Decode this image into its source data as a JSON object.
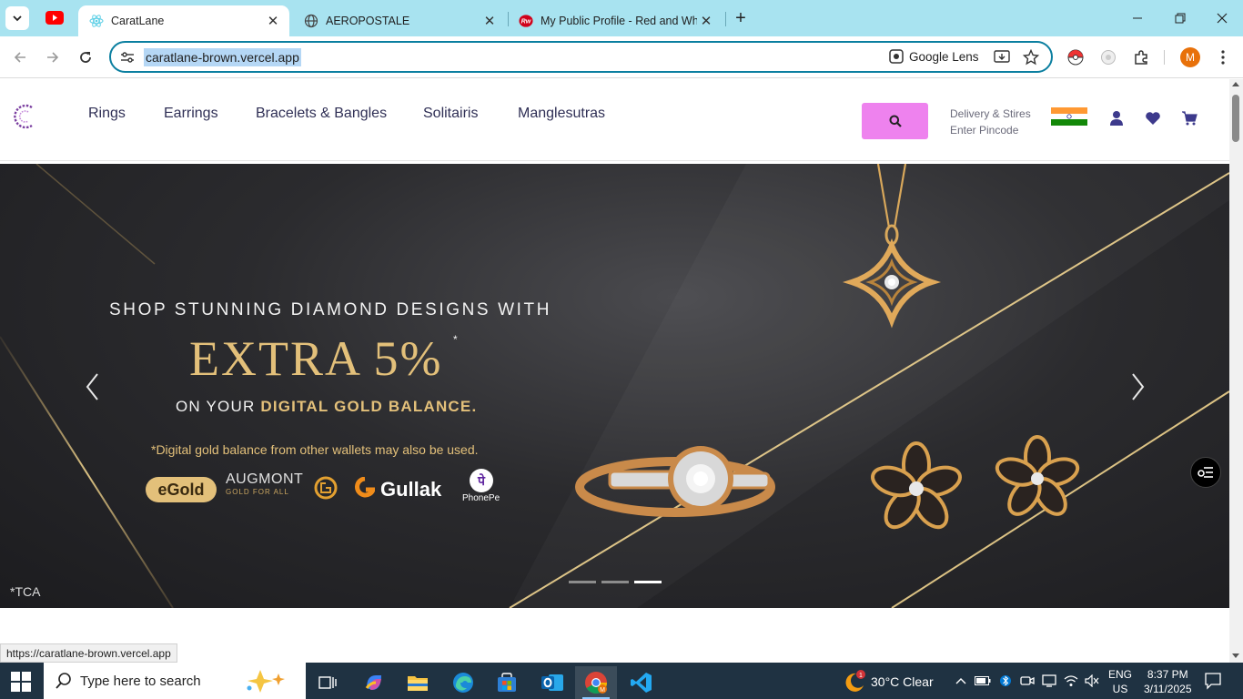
{
  "browser": {
    "tabs": [
      {
        "title": "CaratLane",
        "active": true
      },
      {
        "title": "AEROPOSTALE",
        "active": false
      },
      {
        "title": "My Public Profile - Red and Whi",
        "active": false
      }
    ],
    "url": "caratlane-brown.vercel.app",
    "lens_label": "Google Lens",
    "profile_initial": "M",
    "status_url": "https://caratlane-brown.vercel.app"
  },
  "site": {
    "nav": [
      "Rings",
      "Earrings",
      "Bracelets & Bangles",
      "Solitairis",
      "Manglesutras"
    ],
    "delivery": {
      "line1": "Delivery & Stires",
      "line2": "Enter Pincode"
    },
    "colors": {
      "search_button": "#ee82ee",
      "nav_text": "#2f2f55",
      "gold": "#e3c07a"
    }
  },
  "hero": {
    "line1": "SHOP STUNNING DIAMOND DESIGNS WITH",
    "line2": "EXTRA 5%",
    "star": "*",
    "line3_prefix": "ON YOUR ",
    "line3_bold": "DIGITAL GOLD BALANCE.",
    "note": "*Digital gold balance from other wallets may also be used.",
    "partners": {
      "egold": "eGold",
      "augmont": "AUGMONT",
      "augmont_sub": "GOLD FOR ALL",
      "gullak": "Gullak",
      "phonepe": "PhonePe"
    },
    "tca": "*TCA",
    "slides_total": 3,
    "slide_active": 3
  },
  "taskbar": {
    "search_placeholder": "Type here to search",
    "weather": "30°C  Clear",
    "lang_line1": "ENG",
    "lang_line2": "US",
    "time": "8:37 PM",
    "date": "3/11/2025"
  }
}
